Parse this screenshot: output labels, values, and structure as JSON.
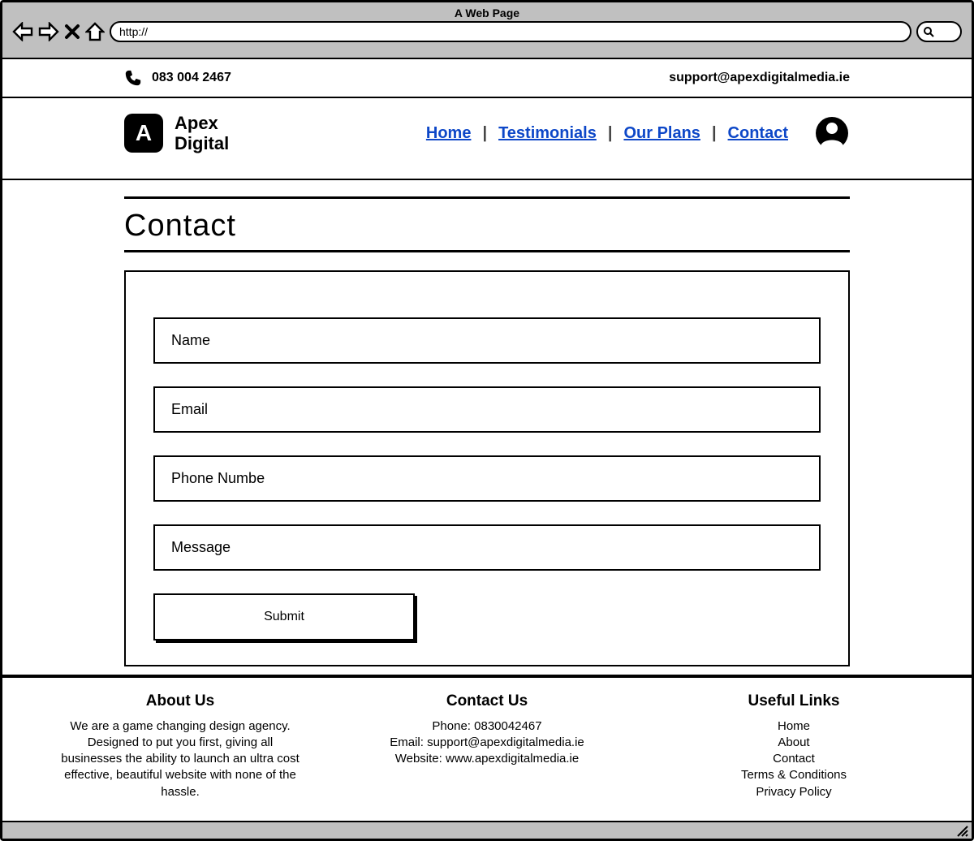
{
  "chrome": {
    "title": "A Web Page",
    "url": "http://"
  },
  "topbar": {
    "phone": "083 004 2467",
    "email": "support@apexdigitalmedia.ie"
  },
  "brand": {
    "line1": "Apex",
    "line2": "Digital",
    "logo_letter": "A"
  },
  "nav": [
    {
      "label": "Home"
    },
    {
      "label": "Testimonials"
    },
    {
      "label": "Our Plans"
    },
    {
      "label": "Contact"
    }
  ],
  "page": {
    "heading": "Contact"
  },
  "form": {
    "name_placeholder": "Name",
    "email_placeholder": "Email",
    "phone_placeholder": "Phone Numbe",
    "message_placeholder": "Message",
    "submit_label": "Submit"
  },
  "footer": {
    "about_title": "About Us",
    "about_text": "We are a game changing design agency. Designed to put you first, giving all businesses the ability to launch an ultra cost effective, beautiful website with none of the hassle.",
    "contact_title": "Contact Us",
    "contact_phone": "Phone: 0830042467",
    "contact_email": "Email: support@apexdigitalmedia.ie",
    "contact_website": "Website: www.apexdigitalmedia.ie",
    "links_title": "Useful Links",
    "links": [
      "Home",
      "About",
      "Contact",
      "Terms & Conditions",
      "Privacy Policy"
    ]
  }
}
